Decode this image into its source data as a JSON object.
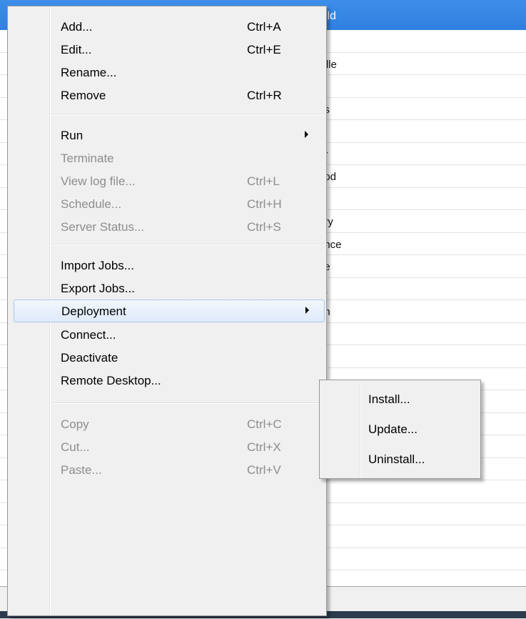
{
  "background": {
    "header_text": "ield",
    "rows": [
      "",
      "ville",
      ":",
      "us",
      "o",
      "er",
      "ood",
      "io",
      "ury",
      "ence",
      "ge",
      "ta",
      "on",
      "",
      "",
      "",
      "",
      "",
      "",
      "",
      "",
      "",
      "",
      "",
      ""
    ]
  },
  "menu": {
    "add": {
      "label": "Add...",
      "shortcut": "Ctrl+A"
    },
    "edit": {
      "label": "Edit...",
      "shortcut": "Ctrl+E"
    },
    "rename": {
      "label": "Rename..."
    },
    "remove": {
      "label": "Remove",
      "shortcut": "Ctrl+R"
    },
    "run": {
      "label": "Run"
    },
    "terminate": {
      "label": "Terminate"
    },
    "view_log": {
      "label": "View log file...",
      "shortcut": "Ctrl+L"
    },
    "schedule": {
      "label": "Schedule...",
      "shortcut": "Ctrl+H"
    },
    "server_status": {
      "label": "Server Status...",
      "shortcut": "Ctrl+S"
    },
    "import_jobs": {
      "label": "Import Jobs..."
    },
    "export_jobs": {
      "label": "Export Jobs..."
    },
    "deployment": {
      "label": "Deployment"
    },
    "connect": {
      "label": "Connect..."
    },
    "deactivate": {
      "label": "Deactivate"
    },
    "remote_desktop": {
      "label": "Remote Desktop..."
    },
    "copy": {
      "label": "Copy",
      "shortcut": "Ctrl+C"
    },
    "cut": {
      "label": "Cut...",
      "shortcut": "Ctrl+X"
    },
    "paste": {
      "label": "Paste...",
      "shortcut": "Ctrl+V"
    }
  },
  "submenu": {
    "install": "Install...",
    "update": "Update...",
    "uninstall": "Uninstall..."
  }
}
